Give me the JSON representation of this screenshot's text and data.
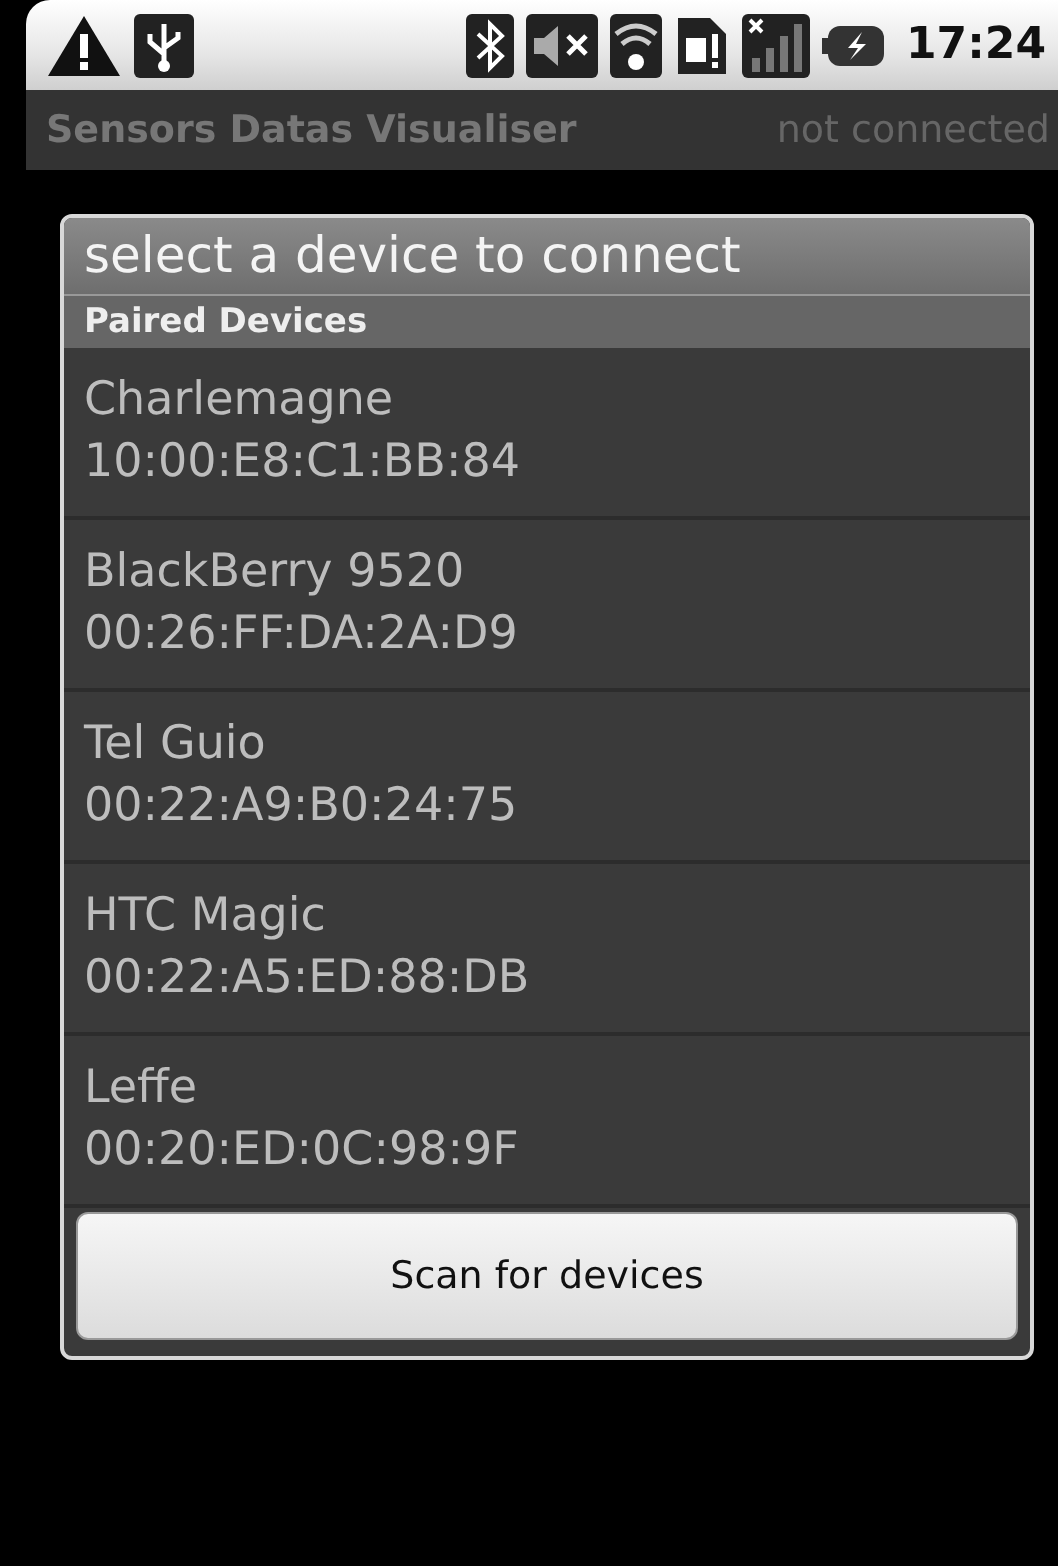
{
  "status_bar": {
    "time": "17:24"
  },
  "app_bar": {
    "title": "Sensors Datas Visualiser",
    "status": "not connected"
  },
  "dialog": {
    "title": "select a device to connect",
    "section": "Paired Devices",
    "devices": [
      {
        "name": "Charlemagne",
        "address": "10:00:E8:C1:BB:84"
      },
      {
        "name": "BlackBerry 9520",
        "address": "00:26:FF:DA:2A:D9"
      },
      {
        "name": "Tel Guio",
        "address": "00:22:A9:B0:24:75"
      },
      {
        "name": "HTC Magic",
        "address": "00:22:A5:ED:88:DB"
      },
      {
        "name": "Leffe",
        "address": "00:20:ED:0C:98:9F"
      }
    ],
    "button": "Scan for devices"
  }
}
